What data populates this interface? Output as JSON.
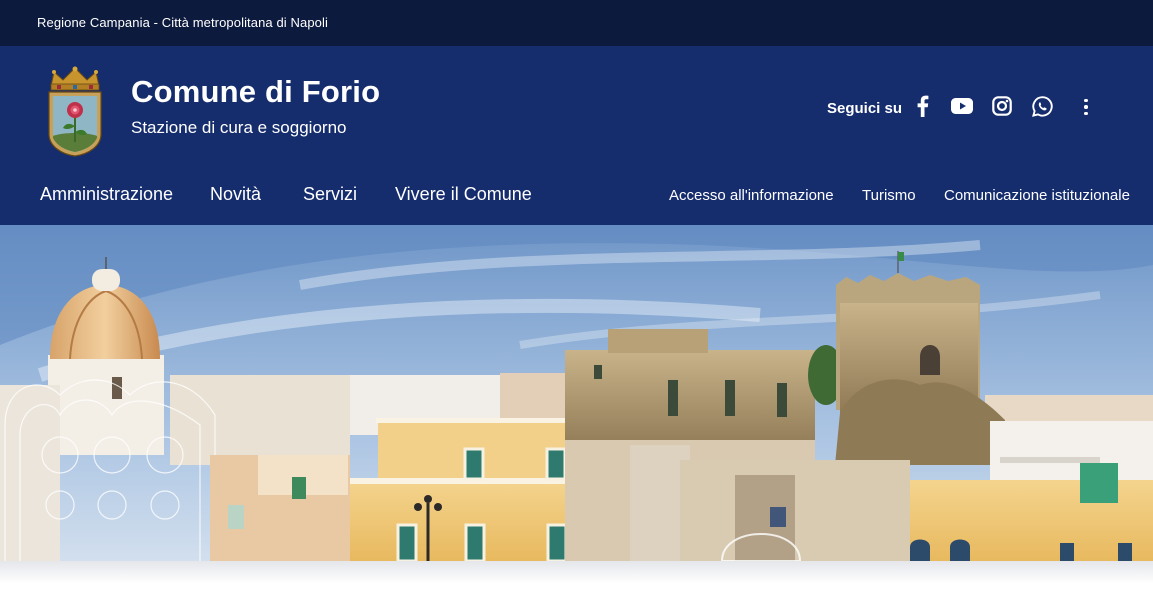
{
  "topbar": {
    "region": "Regione Campania - Città metropolitana di Napoli"
  },
  "header": {
    "title": "Comune di Forio",
    "subtitle": "Stazione di cura e soggiorno",
    "follow_label": "Seguici su",
    "social": [
      {
        "name": "facebook",
        "icon": "facebook-icon"
      },
      {
        "name": "youtube",
        "icon": "youtube-icon"
      },
      {
        "name": "instagram",
        "icon": "instagram-icon"
      },
      {
        "name": "whatsapp",
        "icon": "whatsapp-icon"
      }
    ],
    "more_icon": "more-vertical-icon"
  },
  "main_nav": [
    "Amministrazione",
    "Novità",
    "Servizi",
    "Vivere il Comune"
  ],
  "secondary_nav": [
    "Accesso all'informazione",
    "Turismo",
    "Comunicazione istituzionale"
  ],
  "colors": {
    "topbar": "#0c1a3d",
    "header": "#162d6d",
    "text": "#ffffff"
  },
  "hero": {
    "image": "hero-photo-forio-town"
  }
}
